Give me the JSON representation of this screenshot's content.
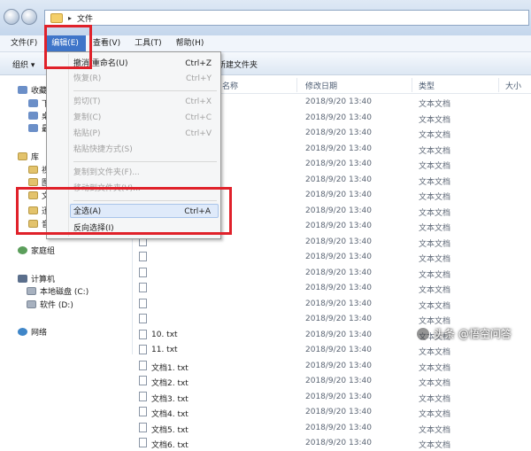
{
  "address": {
    "path": "文件"
  },
  "menubar": [
    "文件(F)",
    "编辑(E)",
    "查看(V)",
    "工具(T)",
    "帮助(H)"
  ],
  "toolbar": {
    "organize": "组织 ▾",
    "new_folder": "新建文件夹"
  },
  "nav": {
    "favorites": "收藏夹",
    "favorites_children": [
      "下",
      "桌",
      "最"
    ],
    "libraries": "库",
    "library_children": [
      "视",
      "图",
      "文",
      "迅",
      "音"
    ],
    "homegroup": "家庭组",
    "computer": "计算机",
    "drives": [
      "本地磁盘 (C:)",
      "软件 (D:)"
    ],
    "network": "网络"
  },
  "columns": {
    "name": "名称",
    "date": "修改日期",
    "type": "类型",
    "size": "大小"
  },
  "files": [
    {
      "name": "",
      "date": "2018/9/20 13:40",
      "type": "文本文档"
    },
    {
      "name": "",
      "date": "2018/9/20 13:40",
      "type": "文本文档"
    },
    {
      "name": "",
      "date": "2018/9/20 13:40",
      "type": "文本文档"
    },
    {
      "name": "",
      "date": "2018/9/20 13:40",
      "type": "文本文档"
    },
    {
      "name": "",
      "date": "2018/9/20 13:40",
      "type": "文本文档"
    },
    {
      "name": "",
      "date": "2018/9/20 13:40",
      "type": "文本文档"
    },
    {
      "name": "",
      "date": "2018/9/20 13:40",
      "type": "文本文档"
    },
    {
      "name": "",
      "date": "2018/9/20 13:40",
      "type": "文本文档"
    },
    {
      "name": "",
      "date": "2018/9/20 13:40",
      "type": "文本文档"
    },
    {
      "name": "",
      "date": "2018/9/20 13:40",
      "type": "文本文档"
    },
    {
      "name": "",
      "date": "2018/9/20 13:40",
      "type": "文本文档"
    },
    {
      "name": "",
      "date": "2018/9/20 13:40",
      "type": "文本文档"
    },
    {
      "name": "",
      "date": "2018/9/20 13:40",
      "type": "文本文档"
    },
    {
      "name": "",
      "date": "2018/9/20 13:40",
      "type": "文本文档"
    },
    {
      "name": "",
      "date": "2018/9/20 13:40",
      "type": "文本文档"
    },
    {
      "name": "10. txt",
      "date": "2018/9/20 13:40",
      "type": "文本文档"
    },
    {
      "name": "11. txt",
      "date": "2018/9/20 13:40",
      "type": "文本文档"
    },
    {
      "name": "文档1. txt",
      "date": "2018/9/20 13:40",
      "type": "文本文档"
    },
    {
      "name": "文档2. txt",
      "date": "2018/9/20 13:40",
      "type": "文本文档"
    },
    {
      "name": "文档3. txt",
      "date": "2018/9/20 13:40",
      "type": "文本文档"
    },
    {
      "name": "文档4. txt",
      "date": "2018/9/20 13:40",
      "type": "文本文档"
    },
    {
      "name": "文档5. txt",
      "date": "2018/9/20 13:40",
      "type": "文本文档"
    },
    {
      "name": "文档6. txt",
      "date": "2018/9/20 13:40",
      "type": "文本文档"
    }
  ],
  "edit_menu": {
    "undo": {
      "label": "撤消 重命名(U)",
      "shortcut": "Ctrl+Z"
    },
    "redo": {
      "label": "恢复(R)",
      "shortcut": "Ctrl+Y"
    },
    "cut": {
      "label": "剪切(T)",
      "shortcut": "Ctrl+X"
    },
    "copy": {
      "label": "复制(C)",
      "shortcut": "Ctrl+C"
    },
    "paste": {
      "label": "粘贴(P)",
      "shortcut": "Ctrl+V"
    },
    "paste_shortcut": {
      "label": "粘贴快捷方式(S)"
    },
    "copy_to": {
      "label": "复制到文件夹(F)..."
    },
    "move_to": {
      "label": "移动到文件夹(V)..."
    },
    "select_all": {
      "label": "全选(A)",
      "shortcut": "Ctrl+A"
    },
    "invert": {
      "label": "反向选择(I)"
    }
  },
  "watermark": "头条 @悟空问答",
  "colors": {
    "highlight_red": "#e0212a",
    "menu_active": "#3f75c9"
  }
}
